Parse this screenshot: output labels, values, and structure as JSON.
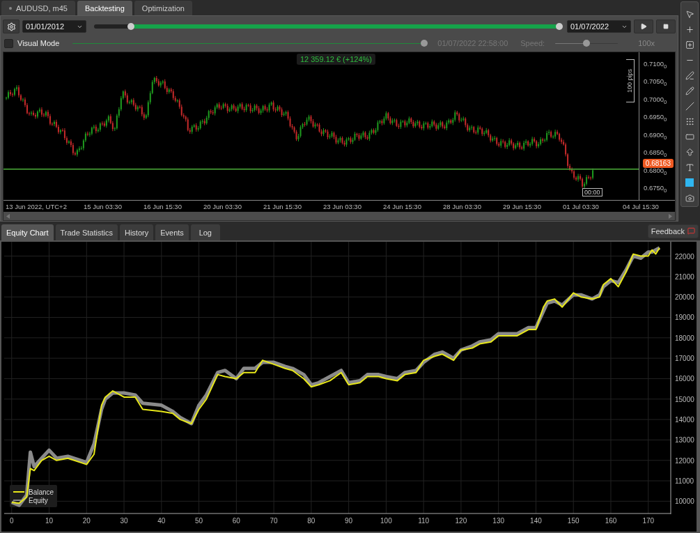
{
  "tabs": [
    {
      "label": "AUDUSD, m45",
      "kind": "symbol",
      "selected": false
    },
    {
      "label": "Backtesting",
      "kind": "page",
      "selected": true
    },
    {
      "label": "Optimization",
      "kind": "page",
      "selected": false
    }
  ],
  "controls": {
    "start_date": "01/01/2012",
    "end_date": "01/07/2022",
    "range_start": {
      "level": 0.08
    },
    "range_end": {
      "level": 1.0
    },
    "visual_mode": {
      "label": "Visual Mode",
      "checked": false
    },
    "playback": {
      "level": 1.0
    },
    "time": "01/07/2022 22:58:00",
    "speed_label": "Speed:",
    "speed": {
      "level": 0.5
    },
    "speed_value": "100x"
  },
  "price_chart": {
    "profit": "12 359.12 € (+124%)",
    "pips_label": "100 pips",
    "y_ticks": [
      "0.7100$_{0}$",
      "0.7050$_{0}$",
      "0.7000$_{0}$",
      "0.6950$_{0}$",
      "0.6900$_{0}$",
      "0.6850$_{0}$",
      "0.6800$_{0}$",
      "0.6750$_{0}$"
    ],
    "current_price": "0.68163",
    "time_marker": "00:00",
    "x_labels": [
      "13 Jun 2022, UTC+2",
      "15 Jun 03:30",
      "16 Jun 15:30",
      "20 Jun 03:30",
      "21 Jun 15:30",
      "23 Jun 03:30",
      "24 Jun 15:30",
      "28 Jun 03:30",
      "29 Jun 15:30",
      "01 Jul 03:30",
      "04 Jul 15:30"
    ]
  },
  "bottom_tabs": [
    {
      "label": "Equity Chart",
      "selected": true
    },
    {
      "label": "Trade Statistics",
      "selected": false
    },
    {
      "label": "History",
      "selected": false
    },
    {
      "label": "Events",
      "selected": false
    },
    {
      "label": "Log",
      "selected": false
    }
  ],
  "feedback": "Feedback",
  "equity_chart": {
    "chart_data": {
      "type": "line",
      "x": [
        0,
        2,
        4,
        5,
        6,
        8,
        10,
        12,
        15,
        20,
        22,
        24,
        25,
        27,
        30,
        33,
        35,
        40,
        43,
        45,
        48,
        50,
        52,
        55,
        57,
        60,
        62,
        65,
        67,
        70,
        73,
        75,
        78,
        80,
        82,
        85,
        88,
        90,
        93,
        95,
        98,
        100,
        103,
        105,
        108,
        110,
        113,
        115,
        118,
        120,
        123,
        125,
        128,
        130,
        133,
        135,
        138,
        140,
        142,
        143,
        145,
        147,
        150,
        152,
        155,
        157,
        158,
        160,
        162,
        164,
        166,
        168,
        170,
        171,
        172,
        173
      ],
      "series": [
        {
          "name": "Balance",
          "color": "#e8e81a",
          "values": [
            9950,
            9900,
            10200,
            11600,
            11500,
            12000,
            12200,
            12000,
            12100,
            11800,
            12300,
            14700,
            15100,
            15400,
            15100,
            15100,
            14500,
            14400,
            14300,
            14000,
            13800,
            14500,
            15000,
            16200,
            16100,
            16000,
            16300,
            16300,
            16900,
            16700,
            16500,
            16400,
            16000,
            15600,
            15700,
            15900,
            16300,
            15700,
            15800,
            16100,
            16100,
            16000,
            15900,
            16200,
            16300,
            16900,
            17100,
            17200,
            16900,
            17400,
            17500,
            17700,
            17800,
            18100,
            18100,
            18100,
            18400,
            18400,
            19500,
            19800,
            19900,
            19500,
            20200,
            20000,
            19900,
            20000,
            20600,
            20900,
            20500,
            21200,
            22100,
            22000,
            22000,
            22300,
            22100,
            22400
          ]
        },
        {
          "name": "Equity",
          "color": "#8a8a8a",
          "values": [
            9950,
            9800,
            10300,
            12400,
            11700,
            12100,
            12500,
            12100,
            12200,
            11900,
            12800,
            14500,
            15000,
            15300,
            15300,
            15200,
            14800,
            14700,
            14400,
            14100,
            13800,
            14700,
            15200,
            16300,
            16400,
            16000,
            16500,
            16500,
            16800,
            16800,
            16600,
            16500,
            16200,
            15700,
            15800,
            16100,
            16400,
            15800,
            15900,
            16200,
            16200,
            16100,
            16000,
            16300,
            16400,
            16800,
            17200,
            17300,
            17000,
            17400,
            17600,
            17800,
            17900,
            18200,
            18200,
            18200,
            18500,
            18500,
            19300,
            19700,
            19800,
            19600,
            20100,
            20100,
            19900,
            20100,
            20500,
            20800,
            20700,
            21300,
            22000,
            21900,
            22200,
            22200,
            22300,
            22400
          ]
        }
      ],
      "xlim": [
        -2,
        176
      ],
      "ylim": [
        9400,
        22700
      ],
      "grid": true,
      "legend": true,
      "xticks": [
        0,
        10,
        20,
        30,
        40,
        50,
        60,
        70,
        80,
        90,
        100,
        110,
        120,
        130,
        140,
        150,
        160,
        170
      ],
      "yticks": [
        10000,
        11000,
        12000,
        13000,
        14000,
        15000,
        16000,
        17000,
        18000,
        19000,
        20000,
        21000,
        22000
      ]
    }
  }
}
